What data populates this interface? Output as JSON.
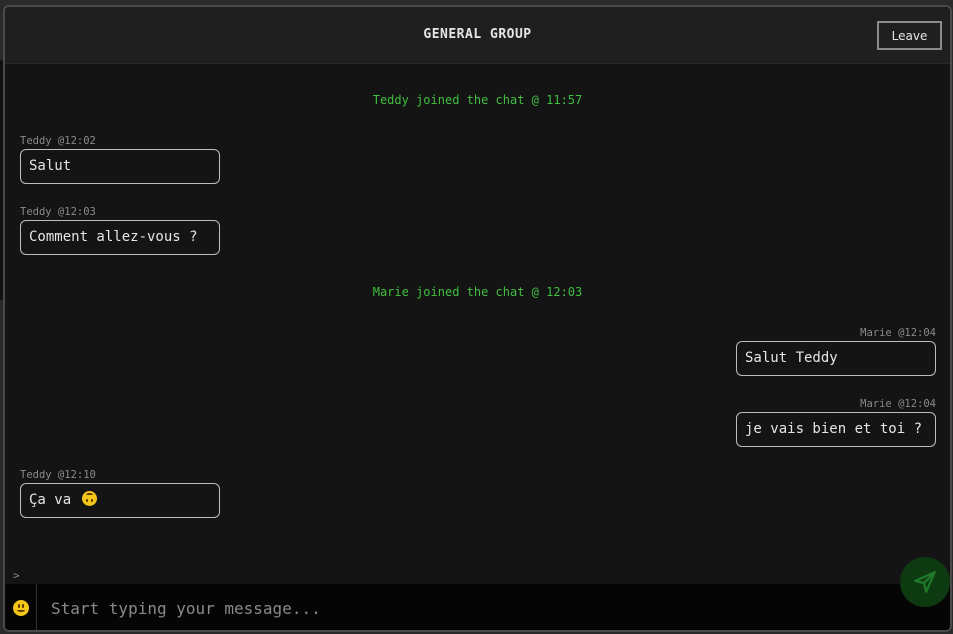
{
  "header": {
    "title": "GENERAL GROUP",
    "leave_label": "Leave"
  },
  "messages": [
    {
      "type": "system",
      "text": "Teddy joined the chat @ 11:57"
    },
    {
      "type": "message",
      "side": "left",
      "meta": "Teddy @12:02",
      "text": "Salut"
    },
    {
      "type": "message",
      "side": "left",
      "meta": "Teddy @12:03",
      "text": "Comment allez-vous ?"
    },
    {
      "type": "system",
      "text": "Marie joined the chat @ 12:03"
    },
    {
      "type": "message",
      "side": "right",
      "meta": "Marie @12:04",
      "text": "Salut Teddy"
    },
    {
      "type": "message",
      "side": "right",
      "meta": "Marie @12:04",
      "text": "je vais bien et toi ?"
    },
    {
      "type": "message",
      "side": "left",
      "meta": "Teddy @12:10",
      "text": "Ça va",
      "emoji": "upside-down-face-icon"
    }
  ],
  "composer": {
    "prompt": ">",
    "placeholder": "Start typing your message...",
    "value": "",
    "emoji_icon": "smiley-icon",
    "send_icon": "send-icon"
  },
  "colors": {
    "background": "#141414",
    "header": "#1f1f1f",
    "system_text": "#3fbf3f",
    "meta_text": "#8a8a8a",
    "bubble_border": "#bdbdbd",
    "send_button": "#0e3a12"
  }
}
